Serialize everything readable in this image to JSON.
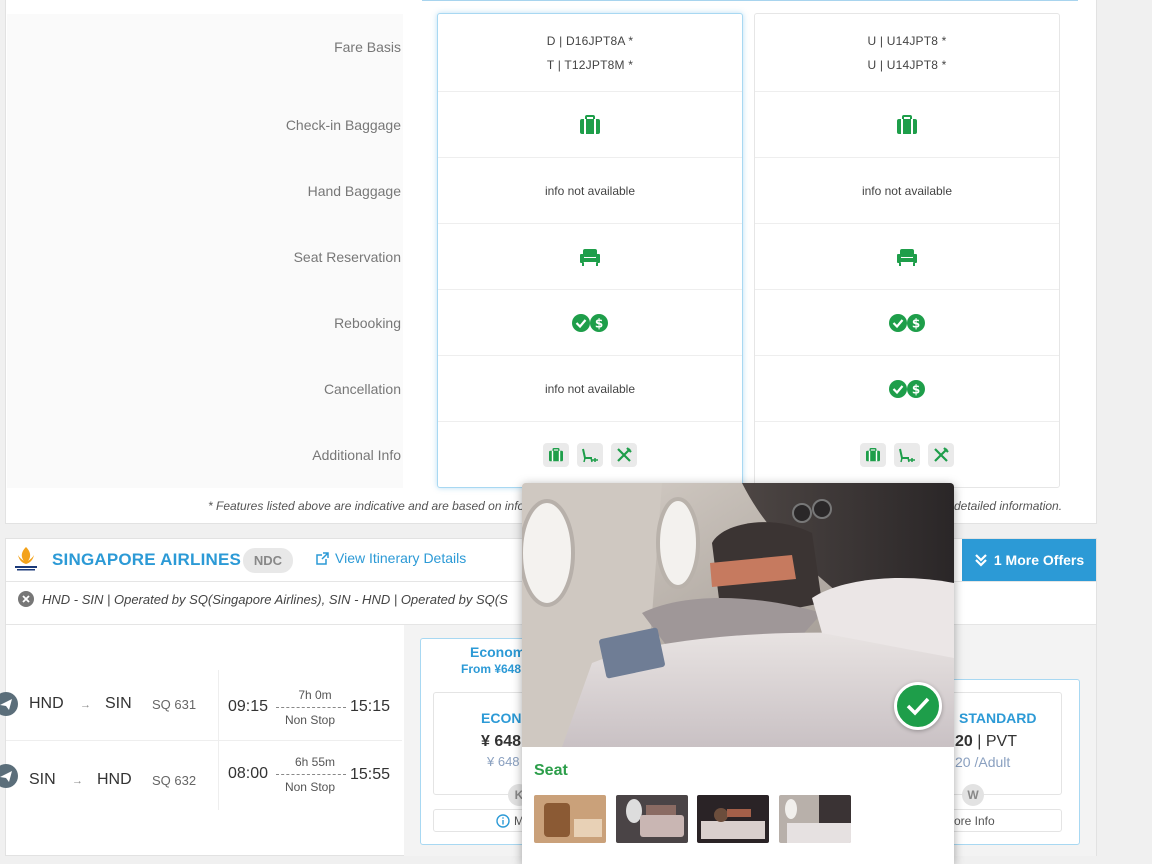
{
  "comparison": {
    "row_labels": [
      "Fare Basis",
      "Check-in Baggage",
      "Hand Baggage",
      "Seat Reservation",
      "Rebooking",
      "Cancellation",
      "Additional Info"
    ],
    "fares": [
      {
        "fare_basis": [
          "D | D16JPT8A *",
          "T | T12JPT8M *"
        ],
        "checkin_baggage_icon": "suitcase-icon",
        "hand_baggage": "info not available",
        "seat_reservation_icon": "seat-icon",
        "rebooking_icon": "check-dollar-icon",
        "cancellation": "info not available",
        "additional_info_icons": [
          "suitcase-icon",
          "seat-legroom-icon",
          "meal-icon"
        ]
      },
      {
        "fare_basis": [
          "U | U14JPT8 *",
          "U | U14JPT8 *"
        ],
        "checkin_baggage_icon": "suitcase-icon",
        "hand_baggage": "info not available",
        "seat_reservation_icon": "seat-icon",
        "rebooking_icon": "check-dollar-icon",
        "cancellation_icon": "check-dollar-icon",
        "additional_info_icons": [
          "suitcase-icon",
          "seat-legroom-icon",
          "meal-icon"
        ]
      }
    ],
    "footnote_left": "* Features listed above are indicative and are based on infor",
    "footnote_right": "detailed information."
  },
  "result": {
    "airline": "SINGAPORE AIRLINES",
    "badge": "NDC",
    "view_itinerary": "View Itinerary Details",
    "more_offers": "1 More Offers",
    "route_summary": "HND - SIN | Operated by SQ(Singapore Airlines), SIN - HND | Operated by SQ(S",
    "segments": [
      {
        "from": "HND",
        "to": "SIN",
        "flight": "SQ 631",
        "depart": "09:15",
        "duration": "7h 0m",
        "stops": "Non Stop",
        "arrive": "15:15"
      },
      {
        "from": "SIN",
        "to": "HND",
        "flight": "SQ 632",
        "depart": "08:00",
        "duration": "6h 55m",
        "stops": "Non Stop",
        "arrive": "15:55"
      }
    ],
    "tab_economy": {
      "title": "Econom",
      "from": "From ¥648"
    },
    "fare_left": {
      "name": "ECONO",
      "price": "¥ 648",
      "sub": "¥ 648",
      "letter": "K",
      "more": "M"
    },
    "fare_right": {
      "name": "STANDARD",
      "price": "20",
      "price_suffix": " | PVT",
      "sub": "20 /Adult",
      "letter": "W",
      "more": "ore Info"
    }
  },
  "popup": {
    "title": "Seat",
    "thumbnails": [
      "seat-photo-1",
      "seat-photo-2",
      "seat-photo-3",
      "seat-photo-4"
    ]
  },
  "colors": {
    "accent_blue": "#2c9ad6",
    "green": "#1e9e4a"
  }
}
